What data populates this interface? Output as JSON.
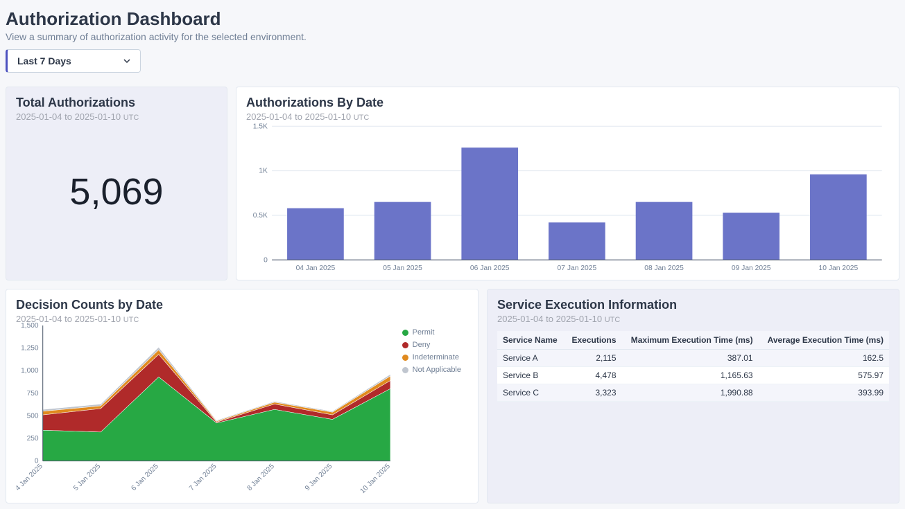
{
  "header": {
    "title": "Authorization Dashboard",
    "subtitle": "View a summary of authorization activity for the selected environment."
  },
  "dropdown": {
    "selected": "Last 7 Days"
  },
  "total_card": {
    "title": "Total Authorizations",
    "range": "2025-01-04 to 2025-01-10",
    "tz": "UTC",
    "value": "5,069"
  },
  "bar_card": {
    "title": "Authorizations By Date",
    "range": "2025-01-04 to 2025-01-10",
    "tz": "UTC"
  },
  "decision_card": {
    "title": "Decision Counts by Date",
    "range": "2025-01-04 to 2025-01-10",
    "tz": "UTC",
    "legend": {
      "permit": "Permit",
      "deny": "Deny",
      "indet": "Indeterminate",
      "na": "Not Applicable"
    }
  },
  "service_card": {
    "title": "Service Execution Information",
    "range": "2025-01-04 to 2025-01-10",
    "tz": "UTC",
    "cols": {
      "name": "Service Name",
      "exec": "Executions",
      "max": "Maximum Execution Time (ms)",
      "avg": "Average Execution Time (ms)"
    },
    "rows": [
      {
        "name": "Service A",
        "exec": "2,115",
        "max": "387.01",
        "avg": "162.5"
      },
      {
        "name": "Service B",
        "exec": "4,478",
        "max": "1,165.63",
        "avg": "575.97"
      },
      {
        "name": "Service C",
        "exec": "3,323",
        "max": "1,990.88",
        "avg": "393.99"
      }
    ]
  },
  "chart_data": [
    {
      "type": "bar",
      "title": "Authorizations By Date",
      "categories": [
        "04 Jan 2025",
        "05 Jan 2025",
        "06 Jan 2025",
        "07 Jan 2025",
        "08 Jan 2025",
        "09 Jan 2025",
        "10 Jan 2025"
      ],
      "values": [
        580,
        650,
        1260,
        420,
        650,
        530,
        960
      ],
      "ylim": [
        0,
        1500
      ],
      "yticks": [
        0,
        500,
        1000,
        1500
      ],
      "ytick_labels": [
        "0",
        "0.5K",
        "1K",
        "1.5K"
      ],
      "color": "#6b74c8"
    },
    {
      "type": "area",
      "title": "Decision Counts by Date",
      "categories": [
        "4 Jan 2025",
        "5 Jan 2025",
        "6 Jan 2025",
        "7 Jan 2025",
        "8 Jan 2025",
        "9 Jan 2025",
        "10 Jan 2025"
      ],
      "series": [
        {
          "name": "Permit",
          "color": "#27a844",
          "values": [
            340,
            320,
            930,
            420,
            570,
            460,
            800
          ]
        },
        {
          "name": "Deny",
          "color": "#b02a2a",
          "values": [
            170,
            260,
            250,
            10,
            60,
            50,
            90
          ]
        },
        {
          "name": "Indeterminate",
          "color": "#e08a1f",
          "values": [
            40,
            30,
            50,
            10,
            20,
            30,
            50
          ]
        },
        {
          "name": "Not Applicable",
          "color": "#c0c6cf",
          "values": [
            20,
            20,
            30,
            10,
            10,
            10,
            20
          ]
        }
      ],
      "ylim": [
        0,
        1500
      ],
      "yticks": [
        0,
        250,
        500,
        750,
        1000,
        1250,
        1500
      ],
      "xrotate": -45
    }
  ]
}
